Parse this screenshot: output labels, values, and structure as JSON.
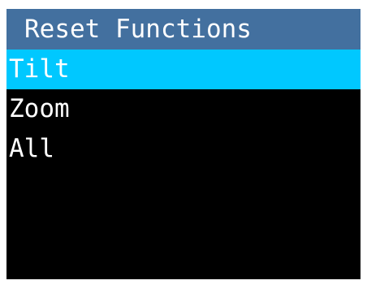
{
  "title": "Reset Functions",
  "colors": {
    "title_bar": "#43709f",
    "selection": "#00c8ff",
    "background": "#000000",
    "text": "#ffffff"
  },
  "menu": {
    "selected_index": 0,
    "items": [
      {
        "label": "Tilt"
      },
      {
        "label": "Zoom"
      },
      {
        "label": "All"
      }
    ]
  }
}
